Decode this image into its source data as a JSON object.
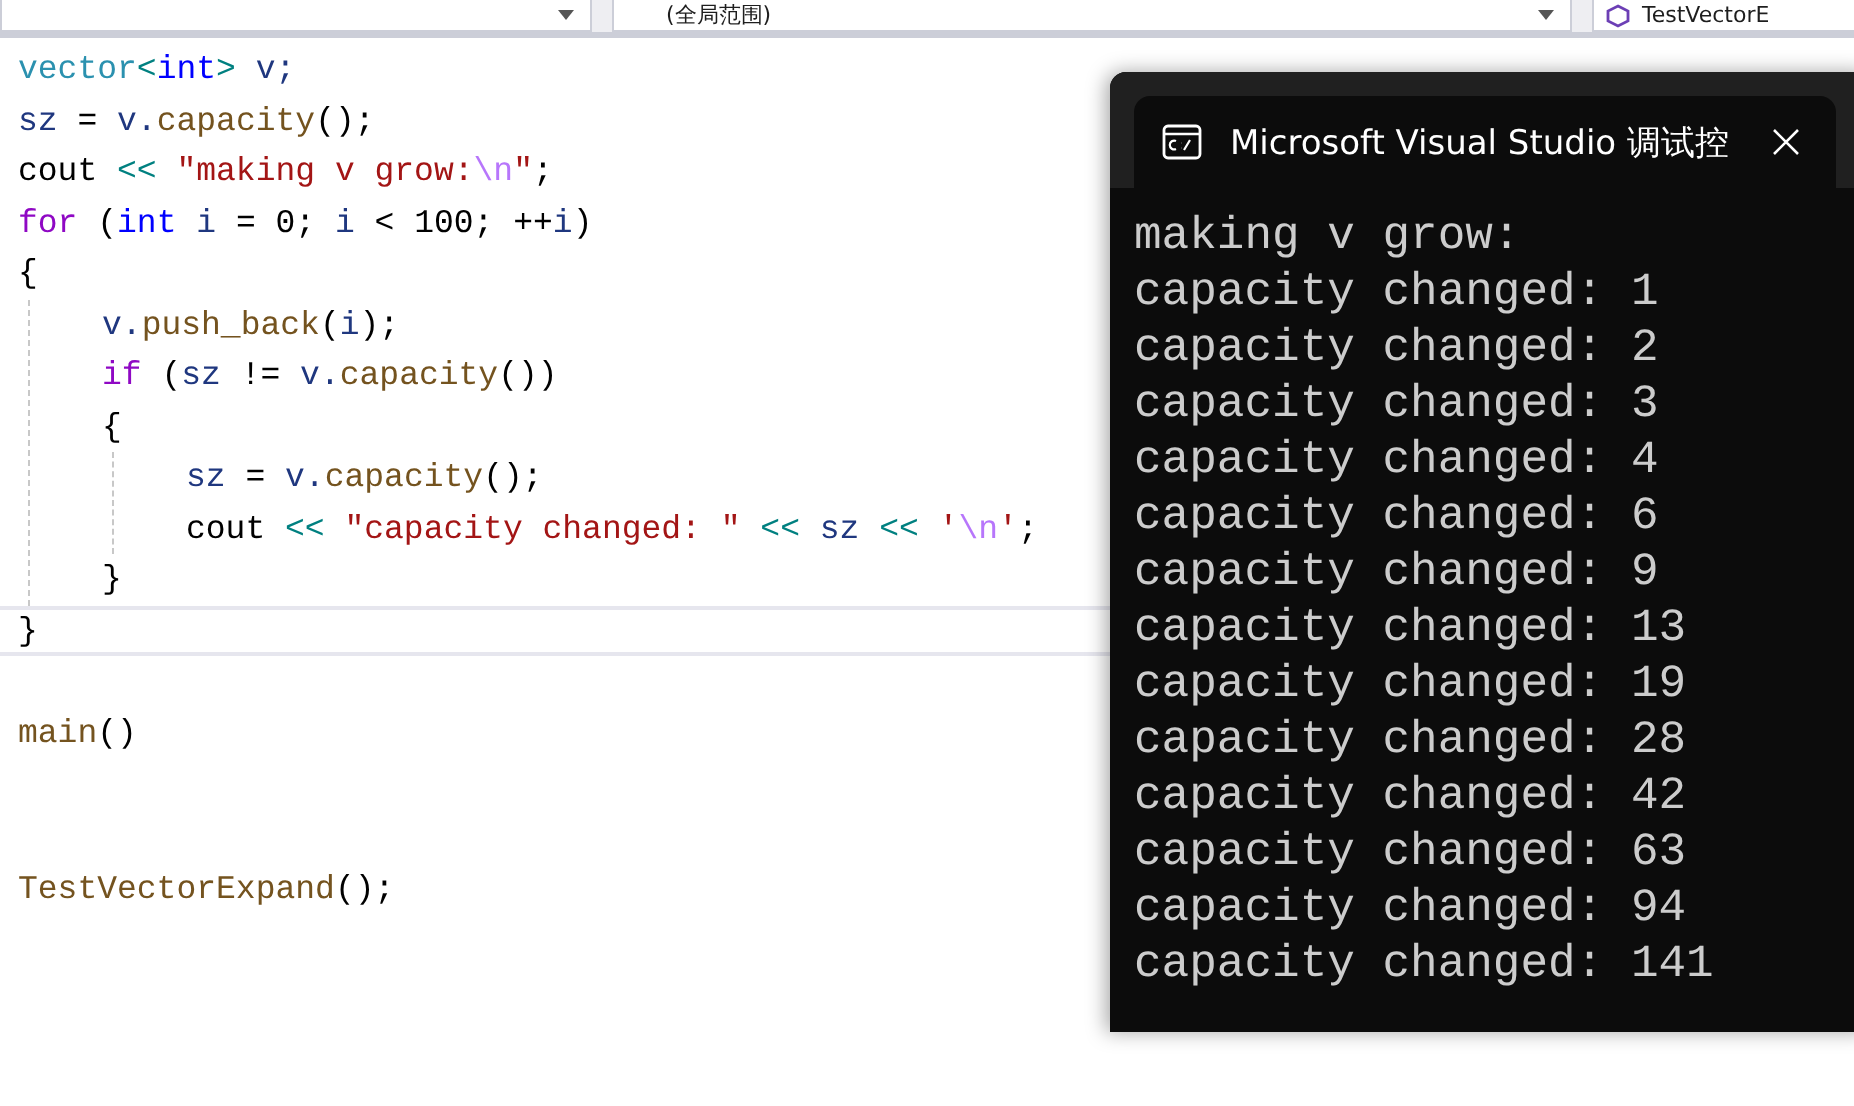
{
  "navigation_bar": {
    "dropdowns": [
      {
        "label": "(全局范围)"
      },
      {
        "label": "TestVectorE"
      }
    ]
  },
  "editor": {
    "blocks": [
      {
        "lines": [
          {
            "tokens": [
              {
                "kind": "type",
                "text": "vector"
              },
              {
                "kind": "op",
                "text": "<"
              },
              {
                "kind": "keyword",
                "text": "int"
              },
              {
                "kind": "op",
                "text": ">"
              },
              {
                "kind": "var",
                "text": " v;"
              }
            ]
          },
          {
            "tokens": [
              {
                "kind": "var",
                "text": "sz"
              },
              {
                "kind": "plain",
                "text": " = "
              },
              {
                "kind": "var",
                "text": "v."
              },
              {
                "kind": "func",
                "text": "capacity"
              },
              {
                "kind": "plain",
                "text": "();"
              }
            ]
          },
          {
            "tokens": [
              {
                "kind": "plain",
                "text": "cout "
              },
              {
                "kind": "op",
                "text": "<<"
              },
              {
                "kind": "string",
                "text": " \"making v grow:"
              },
              {
                "kind": "escape",
                "text": "\\n"
              },
              {
                "kind": "string",
                "text": "\""
              },
              {
                "kind": "plain",
                "text": ";"
              }
            ]
          },
          {
            "tokens": [
              {
                "kind": "control",
                "text": "for"
              },
              {
                "kind": "plain",
                "text": " ("
              },
              {
                "kind": "keyword",
                "text": "int"
              },
              {
                "kind": "var",
                "text": " i"
              },
              {
                "kind": "plain",
                "text": " = 0; "
              },
              {
                "kind": "var",
                "text": "i"
              },
              {
                "kind": "plain",
                "text": " < 100; ++"
              },
              {
                "kind": "var",
                "text": "i"
              },
              {
                "kind": "plain",
                "text": ")"
              }
            ]
          },
          {
            "tokens": [
              {
                "kind": "plain",
                "text": "{"
              }
            ],
            "children": [
              {
                "tokens": [
                  {
                    "kind": "var",
                    "text": "v."
                  },
                  {
                    "kind": "func",
                    "text": "push_back"
                  },
                  {
                    "kind": "plain",
                    "text": "("
                  },
                  {
                    "kind": "var",
                    "text": "i"
                  },
                  {
                    "kind": "plain",
                    "text": ");"
                  }
                ]
              },
              {
                "tokens": [
                  {
                    "kind": "control",
                    "text": "if"
                  },
                  {
                    "kind": "plain",
                    "text": " ("
                  },
                  {
                    "kind": "var",
                    "text": "sz"
                  },
                  {
                    "kind": "plain",
                    "text": " != "
                  },
                  {
                    "kind": "var",
                    "text": "v."
                  },
                  {
                    "kind": "func",
                    "text": "capacity"
                  },
                  {
                    "kind": "plain",
                    "text": "())"
                  }
                ]
              },
              {
                "tokens": [
                  {
                    "kind": "plain",
                    "text": "{"
                  }
                ],
                "children": [
                  {
                    "tokens": [
                      {
                        "kind": "var",
                        "text": "sz"
                      },
                      {
                        "kind": "plain",
                        "text": " = "
                      },
                      {
                        "kind": "var",
                        "text": "v."
                      },
                      {
                        "kind": "func",
                        "text": "capacity"
                      },
                      {
                        "kind": "plain",
                        "text": "();"
                      }
                    ]
                  },
                  {
                    "tokens": [
                      {
                        "kind": "plain",
                        "text": "cout "
                      },
                      {
                        "kind": "op",
                        "text": "<<"
                      },
                      {
                        "kind": "string",
                        "text": " \"capacity changed: \" "
                      },
                      {
                        "kind": "op",
                        "text": "<<"
                      },
                      {
                        "kind": "var",
                        "text": " sz "
                      },
                      {
                        "kind": "op",
                        "text": "<<"
                      },
                      {
                        "kind": "string",
                        "text": " '"
                      },
                      {
                        "kind": "escape",
                        "text": "\\n"
                      },
                      {
                        "kind": "string",
                        "text": "'"
                      },
                      {
                        "kind": "plain",
                        "text": ";"
                      }
                    ]
                  }
                ]
              },
              {
                "tokens": [
                  {
                    "kind": "plain",
                    "text": "}"
                  }
                ]
              }
            ]
          },
          {
            "tokens": [
              {
                "kind": "plain",
                "text": "}"
              }
            ],
            "current": true
          }
        ]
      },
      {
        "lines": [
          {
            "tokens": [
              {
                "kind": "func",
                "text": "main"
              },
              {
                "kind": "plain",
                "text": "()"
              }
            ]
          }
        ]
      },
      {
        "lines": [
          {
            "tokens": [
              {
                "kind": "func",
                "text": "TestVectorExpand"
              },
              {
                "kind": "plain",
                "text": "();"
              }
            ]
          }
        ]
      }
    ]
  },
  "console_window": {
    "title": "Microsoft Visual Studio 调试控",
    "output": [
      "making v grow:",
      "capacity changed: 1",
      "capacity changed: 2",
      "capacity changed: 3",
      "capacity changed: 4",
      "capacity changed: 6",
      "capacity changed: 9",
      "capacity changed: 13",
      "capacity changed: 19",
      "capacity changed: 28",
      "capacity changed: 42",
      "capacity changed: 63",
      "capacity changed: 94",
      "capacity changed: 141"
    ]
  }
}
